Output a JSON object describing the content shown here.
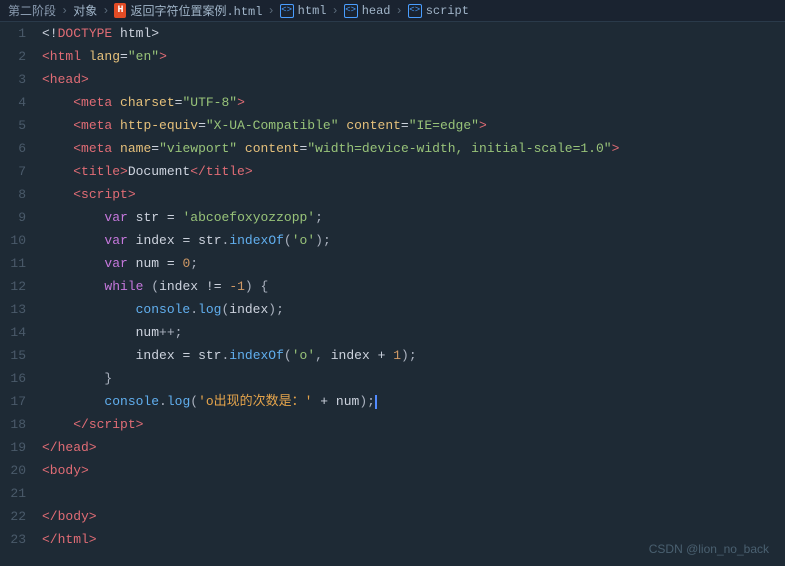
{
  "breadcrumb": {
    "stage": "第二阶段",
    "sep1": ">",
    "obj": "对象",
    "sep2": ">",
    "file": "返回字符位置案例.html",
    "sep3": ">",
    "html": "html",
    "sep4": ">",
    "head": "head",
    "sep5": ">",
    "script": "script"
  },
  "watermark": "CSDN @lion_no_back",
  "lines": [
    {
      "num": 1,
      "content": "DOCTYPE"
    },
    {
      "num": 2,
      "content": "html_lang"
    },
    {
      "num": 3,
      "content": "head_open"
    },
    {
      "num": 4,
      "content": "meta_charset"
    },
    {
      "num": 5,
      "content": "meta_compat"
    },
    {
      "num": 6,
      "content": "meta_viewport"
    },
    {
      "num": 7,
      "content": "title"
    },
    {
      "num": 8,
      "content": "script_open"
    },
    {
      "num": 9,
      "content": "var_str"
    },
    {
      "num": 10,
      "content": "var_index"
    },
    {
      "num": 11,
      "content": "var_num"
    },
    {
      "num": 12,
      "content": "while"
    },
    {
      "num": 13,
      "content": "console_log_index"
    },
    {
      "num": 14,
      "content": "num_inc"
    },
    {
      "num": 15,
      "content": "index_reassign"
    },
    {
      "num": 16,
      "content": "brace_close"
    },
    {
      "num": 17,
      "content": "console_log_result"
    },
    {
      "num": 18,
      "content": "script_close"
    },
    {
      "num": 19,
      "content": "head_close"
    },
    {
      "num": 20,
      "content": "body_open"
    },
    {
      "num": 21,
      "content": "empty"
    },
    {
      "num": 22,
      "content": "body_close"
    },
    {
      "num": 23,
      "content": "html_close"
    }
  ]
}
